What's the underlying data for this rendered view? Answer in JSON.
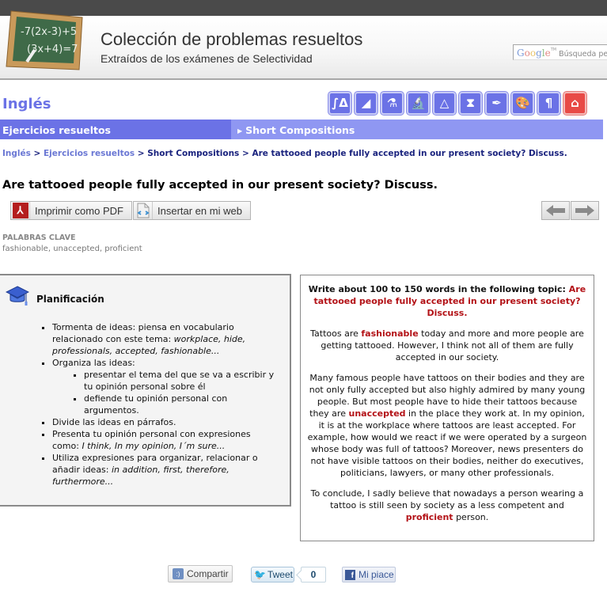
{
  "header": {
    "title": "Colección de problemas resueltos",
    "subtitle": "Extraídos de los exámenes de Selectividad",
    "search_placeholder": "Búsqueda pers",
    "search_brand": [
      "G",
      "o",
      "o",
      "g",
      "l",
      "e"
    ],
    "search_tm": "TM"
  },
  "subject": {
    "title": "Inglés",
    "icons": [
      {
        "name": "mathematics-icon",
        "glyph": "∫Δ"
      },
      {
        "name": "physics-icon",
        "glyph": "◢"
      },
      {
        "name": "chemistry-icon",
        "glyph": "⚗"
      },
      {
        "name": "biology-icon",
        "glyph": "🔬"
      },
      {
        "name": "technical-drawing-icon",
        "glyph": "△"
      },
      {
        "name": "history-icon",
        "glyph": "⧗"
      },
      {
        "name": "language-icon",
        "glyph": "✒"
      },
      {
        "name": "art-icon",
        "glyph": "🎨"
      },
      {
        "name": "philosophy-icon",
        "glyph": "¶"
      },
      {
        "name": "english-icon",
        "glyph": "⌂",
        "active": true
      }
    ]
  },
  "nav": {
    "main": "Ejercicios resueltos",
    "sub": "Short Compositions"
  },
  "breadcrumb": {
    "items": [
      "Inglés",
      "Ejercicios resueltos",
      "Short Compositions",
      "Are tattooed people fully accepted in our present society? Discuss."
    ],
    "separator": ">"
  },
  "page_title": "Are tattooed people fully accepted in our present society? Discuss.",
  "actions": {
    "pdf": "Imprimir como PDF",
    "embed": "Insertar en mi web"
  },
  "keywords": {
    "label": "PALABRAS CLAVE",
    "value": "fashionable, unaccepted, proficient"
  },
  "planning": {
    "title": "Planificación",
    "items": [
      {
        "text": "Tormenta de ideas: piensa en vocabulario relacionado con este tema: ",
        "em": "workplace, hide, professionals, accepted, fashionable..."
      },
      {
        "text": "Organiza las ideas:",
        "sub": [
          "presentar el tema del que se va a escribir y tu opinión personal sobre él",
          "defiende tu opinión personal con argumentos."
        ]
      },
      {
        "text": "Divide las ideas en párrafos."
      },
      {
        "text": "Presenta tu opinión personal con expresiones como: ",
        "em": "I think, In my opinion, I´m sure..."
      },
      {
        "text": "Utiliza expresiones para organizar, relacionar o añadir ideas: ",
        "em": "in addition, first, therefore, furthermore..."
      }
    ]
  },
  "composition": {
    "prompt_intro": "Write about 100 to 150 words in the following topic: ",
    "prompt_topic": "Are tattooed people fully accepted in our present society? Discuss.",
    "p1_a": "Tattoos are ",
    "p1_hl": "fashionable",
    "p1_b": " today and more and more people are getting tattooed. However, I think not all of them are fully accepted in our society.",
    "p2_a": "Many famous people have tattoos on their bodies and they are not only fully accepted but also highly admired by many young people. But most people have to hide their tattoos because they are ",
    "p2_hl": "unaccepted",
    "p2_b": " in the place they work at. In my opinion, it is at the workplace where tattoos are least accepted. For example, how would we react if we were operated by a surgeon whose body was full of tattoos? Moreover, news presenters do not have visible tattoos on their bodies, neither do executives, politicians, lawyers, or many other professionals.",
    "p3_a": "To conclude, I sadly believe that nowadays a person wearing a tattoo is still seen by society as a less competent and ",
    "p3_hl": "proficient",
    "p3_b": " person."
  },
  "share": {
    "compartir": "Compartir",
    "tweet": "Tweet",
    "tweet_count": "0",
    "like": "Mi piace"
  },
  "colors": {
    "accent": "#6b72e6",
    "accent_light": "#8f97f2",
    "highlight": "#b31217",
    "active_icon": "#e84a46"
  }
}
